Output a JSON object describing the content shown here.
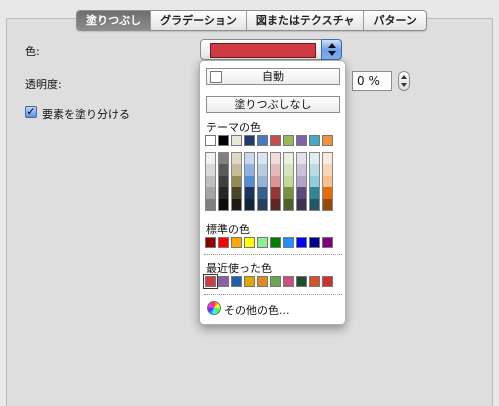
{
  "tabs": [
    "塗りつぶし",
    "グラデーション",
    "図またはテクスチャ",
    "パターン"
  ],
  "active_tab": 0,
  "labels": {
    "color": "色:",
    "transparency": "透明度:",
    "fill_elements": "要素を塗り分ける",
    "transparency_value": "0 %"
  },
  "current_color": "#cf3a45",
  "popup": {
    "auto_label": "自動",
    "no_fill_label": "塗りつぶしなし",
    "theme_title": "テーマの色",
    "standard_title": "標準の色",
    "recent_title": "最近使った色",
    "more_label": "その他の色...",
    "theme_row": [
      "#ffffff",
      "#000000",
      "#ece8d9",
      "#1f3b6e",
      "#4a78be",
      "#c64e4b",
      "#98b85a",
      "#7f63a4",
      "#49a9c4",
      "#f29538"
    ],
    "theme_columns": [
      [
        "#f2f2f2",
        "#d9d9d9",
        "#bfbfbf",
        "#a5a5a5",
        "#7f7f7f"
      ],
      [
        "#7f7f7f",
        "#595959",
        "#3f3f3f",
        "#262626",
        "#0d0d0d"
      ],
      [
        "#ddd9c3",
        "#c4bd97",
        "#948a54",
        "#4a442a",
        "#1d1b10"
      ],
      [
        "#c6d9f0",
        "#8db3e2",
        "#548dd4",
        "#17365d",
        "#0f243e"
      ],
      [
        "#dbe5f1",
        "#b8cce4",
        "#95b3d7",
        "#366092",
        "#244061"
      ],
      [
        "#f2dcdb",
        "#e5b9b7",
        "#d99694",
        "#953734",
        "#632423"
      ],
      [
        "#ebf1dd",
        "#d7e3bc",
        "#c3d69b",
        "#76923c",
        "#4f6128"
      ],
      [
        "#e5e0ec",
        "#ccc1d9",
        "#b2a2c7",
        "#5f497a",
        "#3f3151"
      ],
      [
        "#dbeef3",
        "#b7dde8",
        "#92cddc",
        "#31859b",
        "#205867"
      ],
      [
        "#fdeada",
        "#fbd5b5",
        "#fac08f",
        "#e36c09",
        "#974806"
      ]
    ],
    "standard_colors": [
      "#8b0000",
      "#ff0000",
      "#ffa500",
      "#ffff00",
      "#90ee90",
      "#008000",
      "#1e90ff",
      "#0000ff",
      "#00008b",
      "#800080"
    ],
    "recent_colors": [
      "#cf3a45",
      "#8a5fa8",
      "#1c5fb0",
      "#e0a800",
      "#e08a1e",
      "#6aa84f",
      "#c75082",
      "#1f4f2a",
      "#d94f2b",
      "#d0302e"
    ]
  }
}
